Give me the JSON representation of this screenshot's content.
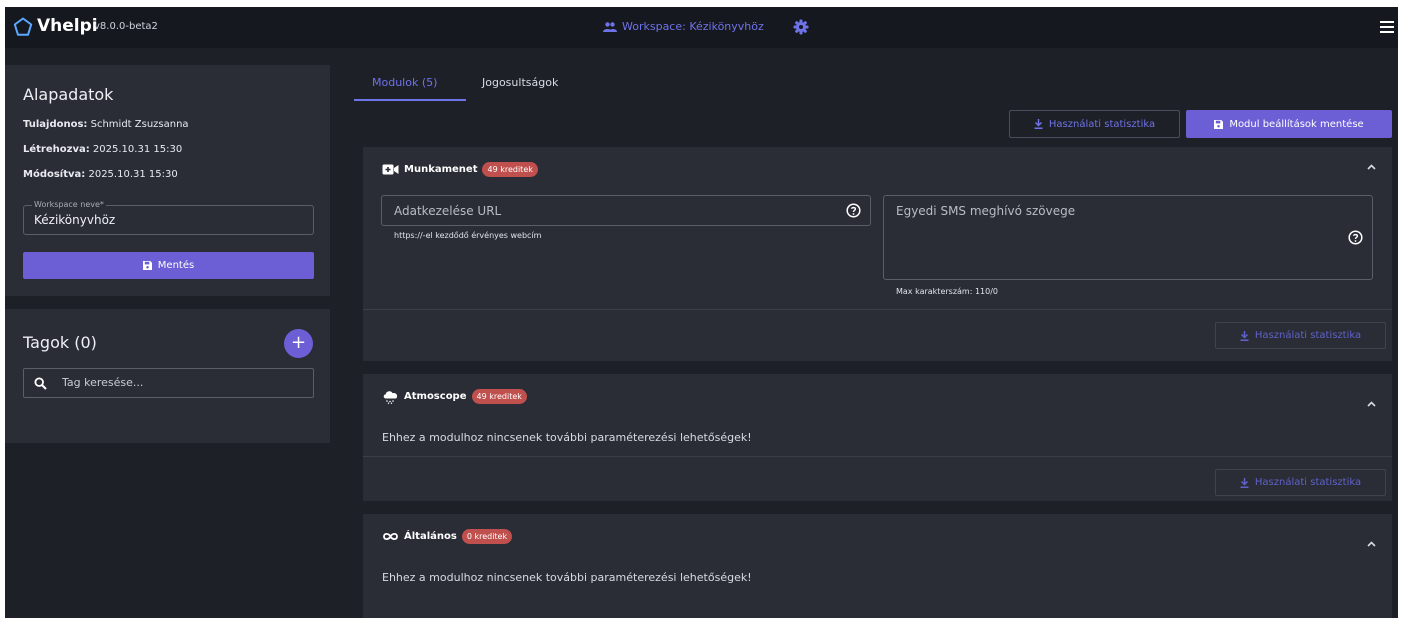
{
  "header": {
    "brand": "Vhelpi",
    "version": "v8.0.0-beta2",
    "workspace_label": "Workspace: Kézikönyvhöz"
  },
  "basics": {
    "title": "Alapadatok",
    "owner_label": "Tulajdonos:",
    "owner_value": "Schmidt Zsuzsanna",
    "created_label": "Létrehozva:",
    "created_value": "2025.10.31 15:30",
    "modified_label": "Módosítva:",
    "modified_value": "2025.10.31 15:30",
    "ws_name_label": "Workspace neve*",
    "ws_name_value": "Kézikönyvhöz",
    "save_label": "Mentés"
  },
  "members": {
    "title": "Tagok (0)",
    "search_placeholder": "Tag keresése..."
  },
  "tabs": [
    {
      "label": "Modulok (5)",
      "active": true
    },
    {
      "label": "Jogosultságok",
      "active": false
    }
  ],
  "toolbar": {
    "stats_label": "Használati statisztika",
    "save_modules_label": "Modul beállítások mentése"
  },
  "modules": [
    {
      "name": "Munkamenet",
      "credits": "49 kreditek",
      "icon": "video-camera-icon",
      "url_field_placeholder": "Adatkezelése URL",
      "url_hint": "https://-el kezdődő érvényes webcím",
      "sms_field_placeholder": "Egyedi SMS meghívó szövege",
      "sms_hint": "Max karakterszám: 110/0",
      "stats_label": "Használati statisztika"
    },
    {
      "name": "Atmoscope",
      "credits": "49 kreditek",
      "icon": "cloud-icon",
      "message": "Ehhez a modulhoz nincsenek további paraméterezési lehetőségek!",
      "stats_label": "Használati statisztika"
    },
    {
      "name": "Általános",
      "credits": "0 kreditek",
      "icon": "infinity-icon",
      "message": "Ehhez a modulhoz nincsenek további paraméterezési lehetőségek!"
    }
  ],
  "colors": {
    "accent": "#6c5fd6",
    "link": "#6f73e8",
    "badge": "#c0504d",
    "panel": "#2a2d36",
    "background": "#1e2027"
  }
}
